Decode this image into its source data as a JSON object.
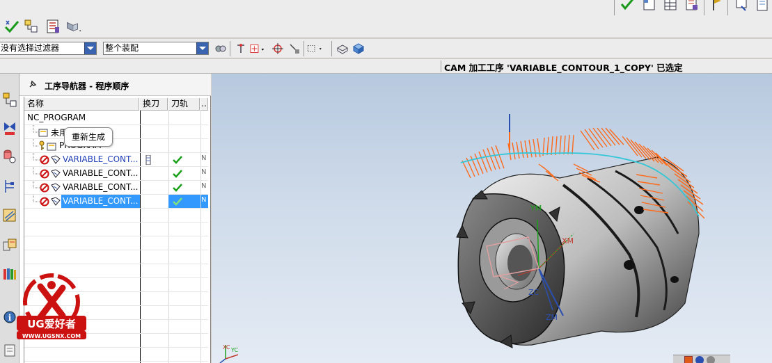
{
  "toolbar": {
    "top_left_icons": [
      "generate-checkmark-icon",
      "operation-navigator-icon",
      "list-icon",
      "display-icon"
    ],
    "top_right_icons": [
      "verify-checkmark-icon",
      "page-icon",
      "table-icon",
      "shop-doc-icon",
      "flag-icon",
      "information-icon",
      "notes-icon"
    ]
  },
  "filter_bar": {
    "selection_filter": "没有选择过滤器",
    "assembly_scope": "整个装配"
  },
  "status": {
    "message": "CAM 加工工序 'VARIABLE_CONTOUR_1_COPY' 已选定"
  },
  "navigator": {
    "title": "工序导航器 - 程序顺序",
    "columns": [
      "名称",
      "换刀",
      "刀轨",
      "…"
    ],
    "rows": [
      {
        "name": "NC_PROGRAM",
        "level": 0,
        "style": "root",
        "toolchange": "",
        "path": "",
        "extra": ""
      },
      {
        "name": "未用",
        "level": 1,
        "style": "group",
        "toolchange": "",
        "path": "",
        "extra": ""
      },
      {
        "name": "PROGRAM",
        "level": 1,
        "style": "group",
        "toolchange": "",
        "path": "",
        "extra": ""
      },
      {
        "name": "VARIABLE_CONT...",
        "level": 2,
        "style": "op-blue",
        "toolchange": "tool",
        "path": "check",
        "extra": "N"
      },
      {
        "name": "VARIABLE_CONT...",
        "level": 2,
        "style": "op",
        "toolchange": "",
        "path": "check",
        "extra": "N"
      },
      {
        "name": "VARIABLE_CONT...",
        "level": 2,
        "style": "op",
        "toolchange": "",
        "path": "check",
        "extra": "N"
      },
      {
        "name": "VARIABLE_CONT...",
        "level": 2,
        "style": "op-selected",
        "toolchange": "",
        "path": "check",
        "extra": "N"
      }
    ],
    "tooltip": "重新生成"
  },
  "graphics": {
    "axis_labels": {
      "ym": "YM",
      "xm": "XM",
      "zc": "ZC",
      "zm": "ZM",
      "xc": "XC",
      "yc": "YC"
    }
  },
  "watermark": {
    "brand": "UG爱好者",
    "url": "WWW.UGSNX.COM"
  },
  "colors": {
    "accent_blue": "#3399ff",
    "toolpath_orange": "#ff6a1a",
    "check_green": "#1aa11a",
    "status_block_red": "#cc1111"
  }
}
